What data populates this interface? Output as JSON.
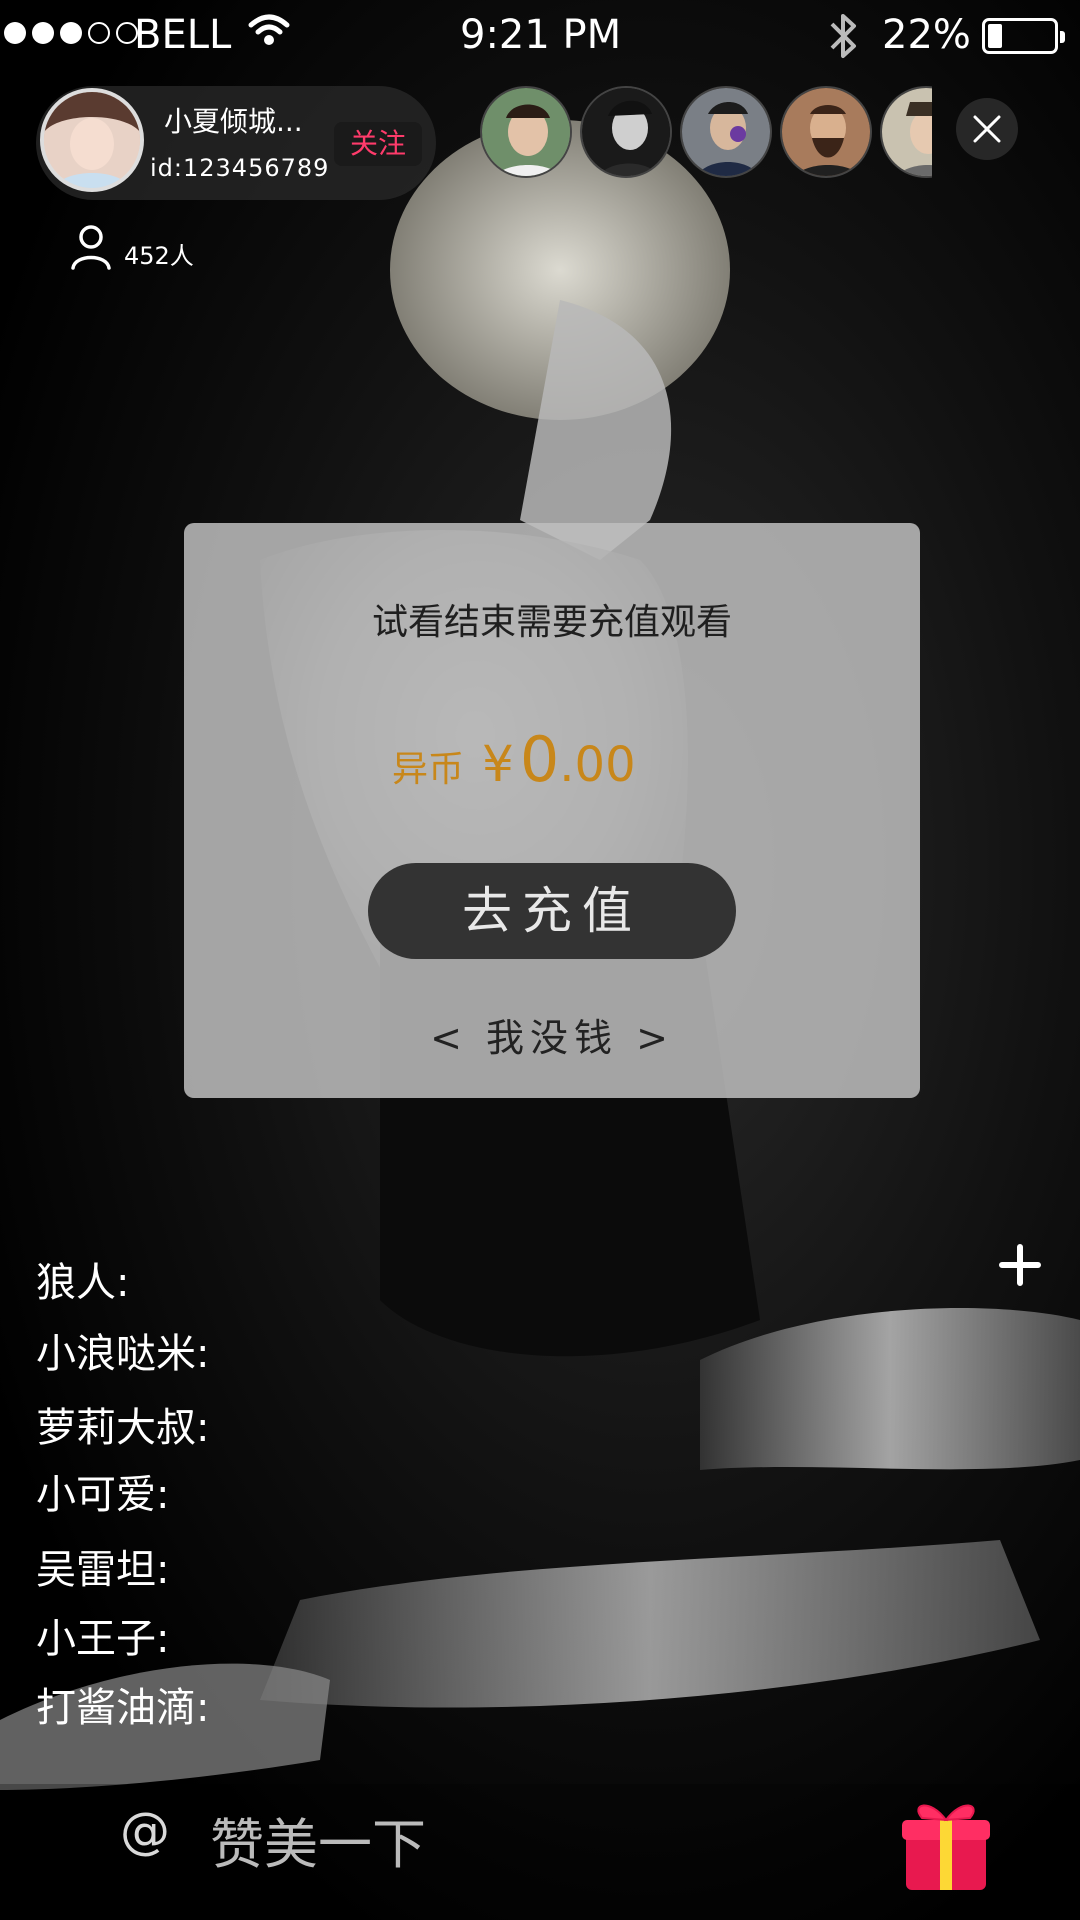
{
  "status_bar": {
    "carrier": "BELL",
    "time": "9:21 PM",
    "battery_text": "22%",
    "battery_level": 0.22,
    "signal_full": 3,
    "signal_total": 5
  },
  "host": {
    "name": "小夏倾城...",
    "id": "id:123456789",
    "follow_label": "关注"
  },
  "online": {
    "count_text": "452人"
  },
  "modal": {
    "message": "试看结束需要充值观看",
    "balance_label": "异币",
    "currency": "¥",
    "amount_int": "0",
    "amount_dec": ".00",
    "recharge_label": "去充值",
    "no_money_label": "< 我没钱 >"
  },
  "chat": {
    "messages": [
      "狼人:",
      "小浪哒米:",
      "萝莉大叔:",
      "小可爱:",
      "吴雷坦:",
      "小王子:",
      "打酱油滴:"
    ]
  },
  "comment": {
    "at_symbol": "@",
    "placeholder": "赞美一下"
  },
  "colors": {
    "accent_gold": "#c8871a",
    "follow_pink": "#ff3b6b"
  },
  "icons": {
    "wifi": "wifi-icon",
    "bluetooth": "bluetooth-icon",
    "close": "close-icon",
    "user": "user-icon",
    "plus": "plus-icon",
    "gift": "gift-icon"
  }
}
